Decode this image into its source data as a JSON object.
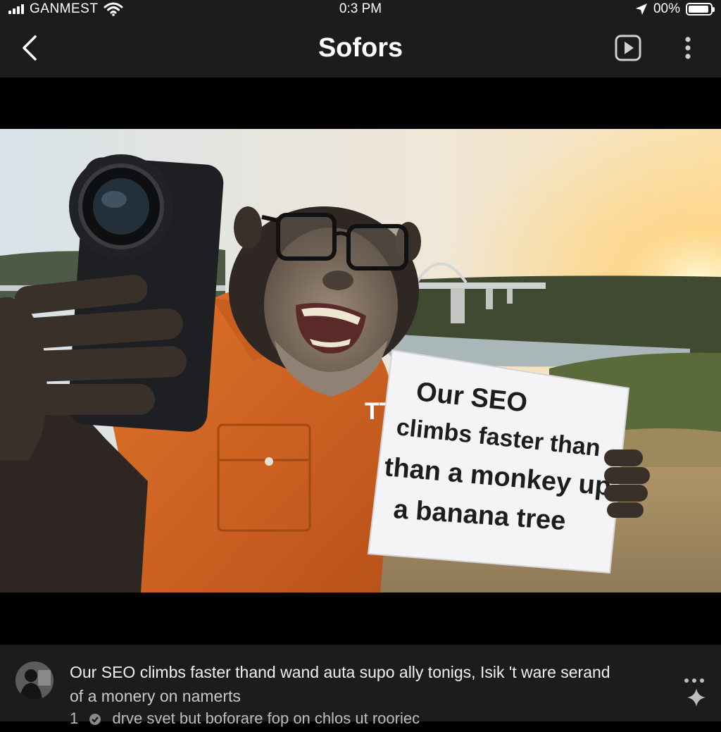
{
  "status_bar": {
    "carrier": "GANMEST",
    "time": "0:3 PM",
    "battery_percent": "00%",
    "icons": [
      "signal-icon",
      "wifi-icon",
      "location-arrow-icon",
      "battery-icon"
    ]
  },
  "nav": {
    "title": "Sofors",
    "icons": [
      "back-chevron-icon",
      "play-icon",
      "more-vertical-icon"
    ]
  },
  "photo": {
    "sign_lines": [
      "Our SEO",
      "climbs faster than",
      "than a monkey up",
      "a banana tree"
    ],
    "shirt_badge": "TT"
  },
  "caption": {
    "line1": "Our SEO climbs faster thand wand auta supo ally tonigs, Isik 't ware serand",
    "line2": "of a monery on namerts",
    "meta_count": "1",
    "meta_text": "drve  svet but boforare fop on chlos ut rooriec",
    "icons": [
      "avatar",
      "more-horizontal-icon",
      "sparkle-icon"
    ]
  },
  "colors": {
    "bar_background": "#1c1c1c",
    "media_background": "#000000",
    "shirt_orange": "#d8641f",
    "sky_warm": "#f7d9a8"
  }
}
